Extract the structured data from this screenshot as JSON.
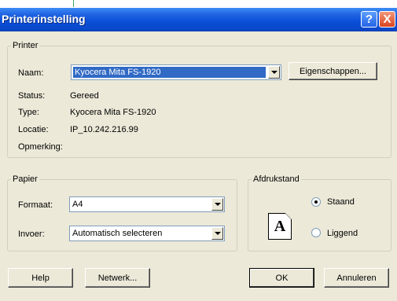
{
  "window": {
    "title": "Printerinstelling",
    "help_glyph": "?",
    "close_glyph": "X",
    "accent_color": "#0a4fd8"
  },
  "printer": {
    "legend": "Printer",
    "name_label": "Naam:",
    "name_value": "Kyocera Mita FS-1920",
    "properties_button": "Eigenschappen...",
    "status_label": "Status:",
    "status_value": "Gereed",
    "type_label": "Type:",
    "type_value": "Kyocera Mita FS-1920",
    "location_label": "Locatie:",
    "location_value": "IP_10.242.216.99",
    "comment_label": "Opmerking:",
    "comment_value": ""
  },
  "paper": {
    "legend": "Papier",
    "format_label": "Formaat:",
    "format_value": "A4",
    "source_label": "Invoer:",
    "source_value": "Automatisch selecteren"
  },
  "orientation": {
    "legend": "Afdrukstand",
    "portrait_label": "Staand",
    "landscape_label": "Liggend",
    "selected": "Staand",
    "page_icon_letter": "A"
  },
  "buttons": {
    "help": "Help",
    "network": "Netwerk...",
    "ok": "OK",
    "cancel": "Annuleren"
  }
}
